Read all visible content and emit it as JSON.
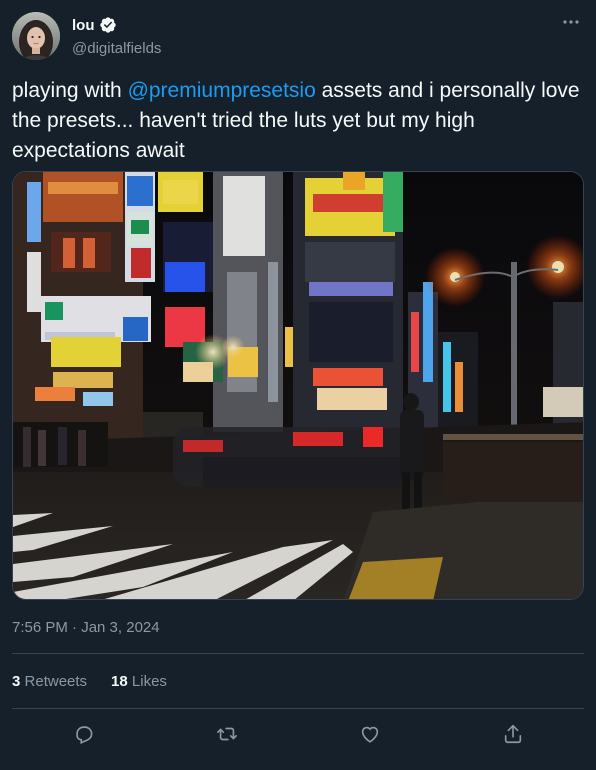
{
  "user": {
    "display_name": "lou",
    "handle": "@digitalfields",
    "verified": true,
    "avatar_icon": "avatar-portrait"
  },
  "tweet": {
    "text_before": "playing with ",
    "mention": "@premiumpresetsio",
    "text_after": " assets and i personally love the presets... haven't tried the luts yet but my high expectations await",
    "timestamp": "7:56 PM · Jan 3, 2024"
  },
  "stats": {
    "retweets_count": "3",
    "retweets_label": "Retweets",
    "likes_count": "18",
    "likes_label": "Likes"
  },
  "media": {
    "description_icon": "night-city-street-photo"
  },
  "actions": [
    "reply-icon",
    "retweet-icon",
    "like-icon",
    "share-icon"
  ],
  "colors": {
    "background": "#15202b",
    "text": "#f7f9f9",
    "secondary": "#8b98a5",
    "accent": "#1d9bf0",
    "border": "#38444d"
  }
}
